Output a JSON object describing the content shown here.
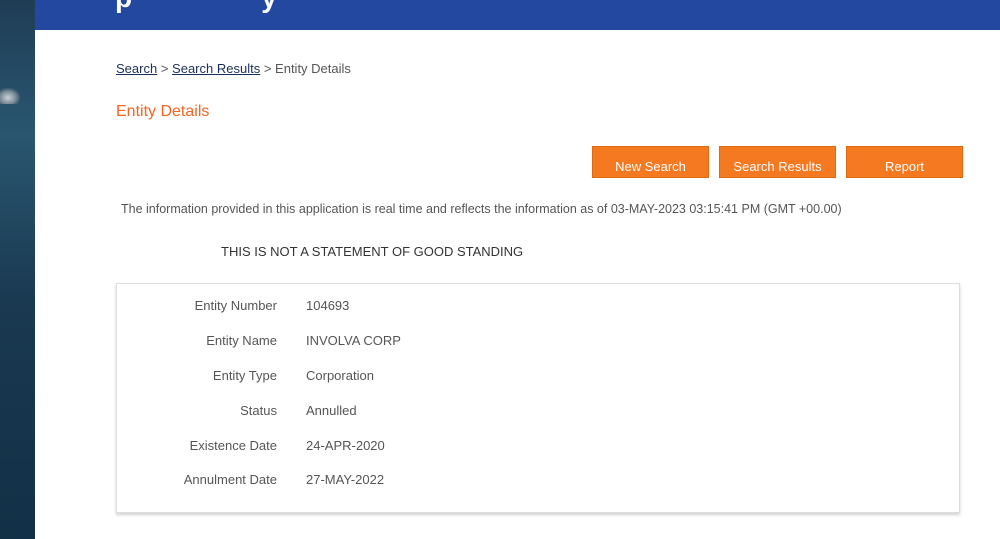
{
  "breadcrumb": {
    "search": "Search",
    "sep1": ">",
    "search_results": "Search Results",
    "sep2": ">",
    "current": "Entity Details"
  },
  "page_title": "Entity Details",
  "buttons": {
    "new_search": "New Search",
    "search_results": "Search Results",
    "report": "Report"
  },
  "info_text": "The information provided in this application is real time and reflects the information as of 03-MAY-2023 03:15:41 PM (GMT +00.00)",
  "notice": "THIS IS NOT A STATEMENT OF GOOD STANDING",
  "details": [
    {
      "label": "Entity Number",
      "value": "104693"
    },
    {
      "label": "Entity Name",
      "value": "INVOLVA CORP"
    },
    {
      "label": "Entity Type",
      "value": "Corporation"
    },
    {
      "label": "Status",
      "value": "Annulled"
    },
    {
      "label": "Existence Date",
      "value": "24-APR-2020"
    },
    {
      "label": "Annulment Date",
      "value": "27-MAY-2022"
    }
  ],
  "colors": {
    "header": "#2348a0",
    "accent": "#f47920",
    "title": "#f26522"
  }
}
